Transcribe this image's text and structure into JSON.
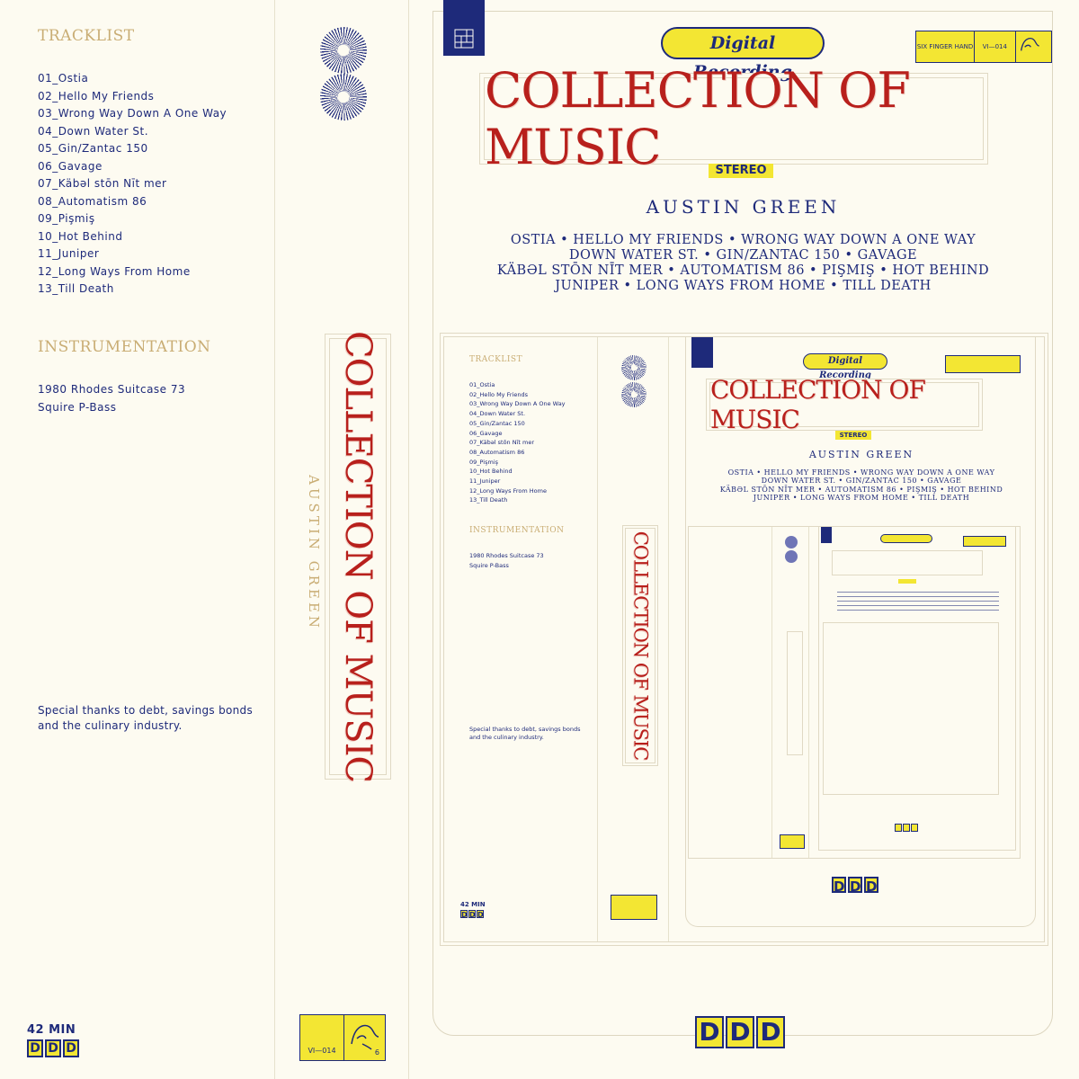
{
  "back_panel": {
    "tracklist_heading": "TRACKLIST",
    "tracks": [
      "01_Ostia",
      "02_Hello My Friends",
      "03_Wrong Way Down A One Way",
      "04_Down Water St.",
      "05_Gin/Zantac 150",
      "06_Gavage",
      "07_Käbəl stōn Nīt mer",
      "08_Automatism 86",
      "09_Pişmiş",
      "10_Hot Behind",
      "11_Juniper",
      "12_Long Ways From Home",
      "13_Till Death"
    ],
    "instrumentation_heading": "INSTRUMENTATION",
    "instruments": [
      "1980 Rhodes Suitcase 73",
      "Squire P-Bass"
    ],
    "thanks_line1": "Special thanks to debt, savings bonds",
    "thanks_line2": "and the culinary industry.",
    "duration": "42 MIN",
    "ddd": [
      "D",
      "D",
      "D"
    ]
  },
  "spine": {
    "title": "COLLECTION OF MUSIC",
    "artist": "AUSTIN GREEN",
    "catalog": "VI—014",
    "label_mark": "6",
    "icons": [
      "sunburst-icon",
      "sunburst-icon",
      "hand-logo-icon"
    ]
  },
  "front": {
    "digital_recording": "Digital Recording",
    "label_name": "SIX FINGER HAND",
    "catalog": "VI—014",
    "title": "COLLECTION OF MUSIC",
    "stereo": "STEREO",
    "artist": "AUSTIN GREEN",
    "song_lines": [
      "OSTIA • HELLO MY FRIENDS • WRONG WAY DOWN A ONE WAY",
      "DOWN WATER ST. • GIN/ZANTAC 150 • GAVAGE",
      "KÄBƏL STŌN NĪT MER • AUTOMATISM 86 • PIŞMIŞ • HOT BEHIND",
      "JUNIPER • LONG WAYS FROM HOME • TILL DEATH"
    ],
    "ddd": [
      "D",
      "D",
      "D"
    ]
  },
  "colors": {
    "background": "#fdfbf1",
    "navy": "#1e2a7a",
    "gold": "#c9ad74",
    "red": "#b8201c",
    "yellow": "#f3e633"
  }
}
